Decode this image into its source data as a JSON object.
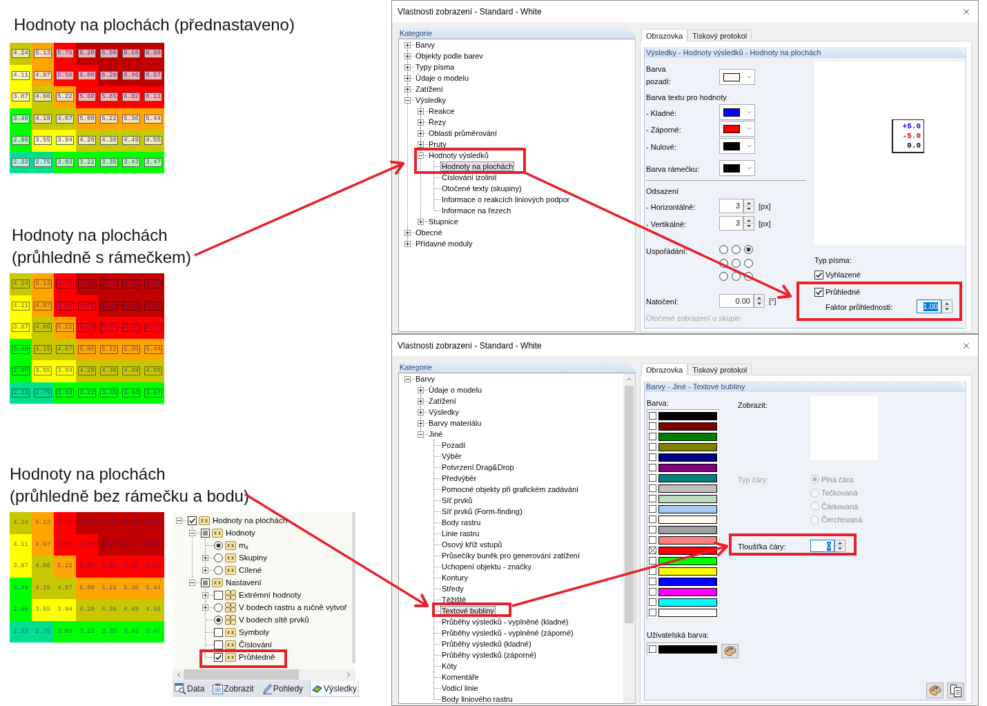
{
  "examples": [
    {
      "kind": "opaque_framed",
      "title": [
        "Hodnoty na plochách (přednastaveno)"
      ],
      "rows": [
        {
          "cells": [
            {
              "value": "4.24",
              "color": "#c8c800"
            },
            {
              "value": "5.13",
              "color": "#ffa500"
            },
            {
              "value": "5.76",
              "color": "#ff0000"
            },
            {
              "value": "6.20",
              "color": "#c00000"
            },
            {
              "value": "6.50",
              "color": "#c00000"
            },
            {
              "value": "6.69",
              "color": "#c00000"
            },
            {
              "value": "6.80",
              "color": "#c00000"
            }
          ]
        },
        {
          "cells": [
            {
              "value": "4.11",
              "color": "#ffff00"
            },
            {
              "value": "4.97",
              "color": "#ffa500"
            },
            {
              "value": "5.58",
              "color": "#ff0000"
            },
            {
              "value": "6.00",
              "color": "#ff0000"
            },
            {
              "value": "6.28",
              "color": "#c00000"
            },
            {
              "value": "6.46",
              "color": "#c00000"
            },
            {
              "value": "6.57",
              "color": "#c00000"
            }
          ]
        },
        {
          "cells": [
            {
              "value": "3.87",
              "color": "#ffff00"
            },
            {
              "value": "4.66",
              "color": "#c8c800"
            },
            {
              "value": "5.22",
              "color": "#ffa500"
            },
            {
              "value": "5.60",
              "color": "#ff0000"
            },
            {
              "value": "5.85",
              "color": "#ff0000"
            },
            {
              "value": "6.02",
              "color": "#ff0000"
            },
            {
              "value": "6.11",
              "color": "#ff0000"
            }
          ]
        },
        {
          "cells": [
            {
              "value": "3.49",
              "color": "#00ff00"
            },
            {
              "value": "4.19",
              "color": "#c8c800"
            },
            {
              "value": "4.67",
              "color": "#c8c800"
            },
            {
              "value": "5.00",
              "color": "#ffa500"
            },
            {
              "value": "5.22",
              "color": "#ffa500"
            },
            {
              "value": "5.36",
              "color": "#ffa500"
            },
            {
              "value": "5.44",
              "color": "#ffa500"
            }
          ]
        },
        {
          "cells": [
            {
              "value": "2.98",
              "color": "#00ff00"
            },
            {
              "value": "3.55",
              "color": "#ffff00"
            },
            {
              "value": "3.94",
              "color": "#ffff00"
            },
            {
              "value": "4.20",
              "color": "#c8c800"
            },
            {
              "value": "4.38",
              "color": "#c8c800"
            },
            {
              "value": "4.49",
              "color": "#c8c800"
            },
            {
              "value": "4.55",
              "color": "#c8c800"
            }
          ]
        },
        {
          "cells": [
            {
              "value": "2.33",
              "color": "#00e08c"
            },
            {
              "value": "2.75",
              "color": "#00e08c"
            },
            {
              "value": "3.03",
              "color": "#00ff00"
            },
            {
              "value": "3.22",
              "color": "#00ff00"
            },
            {
              "value": "3.35",
              "color": "#00ff00"
            },
            {
              "value": "3.43",
              "color": "#00ff00"
            },
            {
              "value": "3.47",
              "color": "#00ff00"
            }
          ]
        }
      ]
    },
    {
      "kind": "transparent_framed",
      "title": [
        "Hodnoty na plochách",
        "(průhledně s rámečkem)"
      ],
      "rows": [
        {
          "cells": [
            {
              "value": "4.24",
              "color": "#c8c800"
            },
            {
              "value": "5.13",
              "color": "#ffa500"
            },
            {
              "value": "5.76",
              "color": "#ff0000"
            },
            {
              "value": "6.20",
              "color": "#c00000"
            },
            {
              "value": "6.50",
              "color": "#c00000"
            },
            {
              "value": "6.69",
              "color": "#c00000"
            },
            {
              "value": "6.80",
              "color": "#c00000"
            }
          ]
        },
        {
          "cells": [
            {
              "value": "4.11",
              "color": "#ffff00"
            },
            {
              "value": "4.97",
              "color": "#ffa500"
            },
            {
              "value": "5.58",
              "color": "#ff0000"
            },
            {
              "value": "6.00",
              "color": "#ff0000"
            },
            {
              "value": "6.28",
              "color": "#c00000"
            },
            {
              "value": "6.46",
              "color": "#c00000"
            },
            {
              "value": "6.57",
              "color": "#c00000"
            }
          ]
        },
        {
          "cells": [
            {
              "value": "3.87",
              "color": "#ffff00"
            },
            {
              "value": "4.66",
              "color": "#c8c800"
            },
            {
              "value": "5.22",
              "color": "#ffa500"
            },
            {
              "value": "5.60",
              "color": "#ff0000"
            },
            {
              "value": "5.85",
              "color": "#ff0000"
            },
            {
              "value": "6.02",
              "color": "#ff0000"
            },
            {
              "value": "6.11",
              "color": "#ff0000"
            }
          ]
        },
        {
          "cells": [
            {
              "value": "3.49",
              "color": "#00ff00"
            },
            {
              "value": "4.19",
              "color": "#c8c800"
            },
            {
              "value": "4.67",
              "color": "#c8c800"
            },
            {
              "value": "5.00",
              "color": "#ffa500"
            },
            {
              "value": "5.22",
              "color": "#ffa500"
            },
            {
              "value": "5.36",
              "color": "#ffa500"
            },
            {
              "value": "5.44",
              "color": "#ffa500"
            }
          ]
        },
        {
          "cells": [
            {
              "value": "2.98",
              "color": "#00ff00"
            },
            {
              "value": "3.55",
              "color": "#ffff00"
            },
            {
              "value": "3.94",
              "color": "#ffff00"
            },
            {
              "value": "4.20",
              "color": "#c8c800"
            },
            {
              "value": "4.38",
              "color": "#c8c800"
            },
            {
              "value": "4.49",
              "color": "#c8c800"
            },
            {
              "value": "4.55",
              "color": "#c8c800"
            }
          ]
        },
        {
          "cells": [
            {
              "value": "2.33",
              "color": "#00e08c"
            },
            {
              "value": "2.75",
              "color": "#00e08c"
            },
            {
              "value": "3.03",
              "color": "#00ff00"
            },
            {
              "value": "3.22",
              "color": "#00ff00"
            },
            {
              "value": "3.35",
              "color": "#00ff00"
            },
            {
              "value": "3.43",
              "color": "#00ff00"
            },
            {
              "value": "3.47",
              "color": "#00ff00"
            }
          ]
        }
      ]
    },
    {
      "kind": "transparent_plain",
      "title": [
        "Hodnoty na plochách",
        "(průhledně bez rámečku a bodu)"
      ],
      "rows": [
        {
          "cells": [
            {
              "value": "4.24",
              "color": "#c8c800"
            },
            {
              "value": "5.13",
              "color": "#ffa500"
            },
            {
              "value": "5.76",
              "color": "#ff0000"
            },
            {
              "value": "6.20",
              "color": "#c00000"
            },
            {
              "value": "6.50",
              "color": "#c00000"
            },
            {
              "value": "6.69",
              "color": "#c00000"
            },
            {
              "value": "6.80",
              "color": "#c00000"
            }
          ]
        },
        {
          "cells": [
            {
              "value": "4.11",
              "color": "#ffff00"
            },
            {
              "value": "4.97",
              "color": "#ffa500"
            },
            {
              "value": "5.58",
              "color": "#ff0000"
            },
            {
              "value": "6.00",
              "color": "#ff0000"
            },
            {
              "value": "6.28",
              "color": "#c00000"
            },
            {
              "value": "6.46",
              "color": "#c00000"
            },
            {
              "value": "6.57",
              "color": "#c00000"
            }
          ]
        },
        {
          "cells": [
            {
              "value": "3.87",
              "color": "#ffff00"
            },
            {
              "value": "4.66",
              "color": "#c8c800"
            },
            {
              "value": "5.22",
              "color": "#ffa500"
            },
            {
              "value": "5.60",
              "color": "#ff0000"
            },
            {
              "value": "5.85",
              "color": "#ff0000"
            },
            {
              "value": "6.02",
              "color": "#ff0000"
            },
            {
              "value": "6.11",
              "color": "#ff0000"
            }
          ]
        },
        {
          "cells": [
            {
              "value": "3.49",
              "color": "#00ff00"
            },
            {
              "value": "4.19",
              "color": "#c8c800"
            },
            {
              "value": "4.67",
              "color": "#c8c800"
            },
            {
              "value": "5.00",
              "color": "#ffa500"
            },
            {
              "value": "5.22",
              "color": "#ffa500"
            },
            {
              "value": "5.36",
              "color": "#ffa500"
            },
            {
              "value": "5.44",
              "color": "#ffa500"
            }
          ]
        },
        {
          "cells": [
            {
              "value": "2.98",
              "color": "#00ff00"
            },
            {
              "value": "3.55",
              "color": "#ffff00"
            },
            {
              "value": "3.94",
              "color": "#ffff00"
            },
            {
              "value": "4.20",
              "color": "#c8c800"
            },
            {
              "value": "4.38",
              "color": "#c8c800"
            },
            {
              "value": "4.49",
              "color": "#c8c800"
            },
            {
              "value": "4.55",
              "color": "#c8c800"
            }
          ]
        },
        {
          "cells": [
            {
              "value": "2.33",
              "color": "#00e08c"
            },
            {
              "value": "2.75",
              "color": "#00e08c"
            },
            {
              "value": "3.03",
              "color": "#00ff00"
            },
            {
              "value": "3.22",
              "color": "#00ff00"
            },
            {
              "value": "3.35",
              "color": "#00ff00"
            },
            {
              "value": "3.43",
              "color": "#00ff00"
            },
            {
              "value": "3.47",
              "color": "#00ff00"
            }
          ]
        }
      ],
      "navigator": {
        "tree": [
          {
            "label": "Hodnoty na plochách",
            "kind": "check_tag",
            "checked": true,
            "partial": false,
            "expanded": true,
            "children": [
              {
                "label": "Hodnoty",
                "kind": "check_tag",
                "checked": false,
                "partial": true,
                "expanded": true,
                "children": [
                  {
                    "label": "m$_{x}$",
                    "kind": "radio_tag",
                    "selected": true
                  },
                  {
                    "label": "Skupiny",
                    "kind": "radio_tag",
                    "selected": false,
                    "expanded": false
                  },
                  {
                    "label": "Cílené",
                    "kind": "radio_tag",
                    "selected": false,
                    "expanded": false
                  }
                ]
              },
              {
                "label": "Nastavení",
                "kind": "check_tag",
                "checked": false,
                "partial": true,
                "expanded": true,
                "children": [
                  {
                    "label": "Extrémní hodnoty",
                    "kind": "check_grid",
                    "checked": false,
                    "partial": false,
                    "expanded": false
                  },
                  {
                    "label": "V bodech rastru a ručně vytvoř",
                    "kind": "radio_grid",
                    "selected": false,
                    "expanded": false
                  },
                  {
                    "label": "V bodech sítě prvků",
                    "kind": "radio_grid",
                    "selected": true
                  },
                  {
                    "label": "Symboly",
                    "kind": "check_tag",
                    "checked": false,
                    "partial": false
                  },
                  {
                    "label": "Číslování",
                    "kind": "check_tag",
                    "checked": false,
                    "partial": false
                  },
                  {
                    "label": "Průhledně",
                    "kind": "check_tag",
                    "checked": true,
                    "partial": false
                  }
                ]
              }
            ]
          }
        ],
        "tabs": [
          {
            "label": "Data",
            "selected": false
          },
          {
            "label": "Zobrazit",
            "selected": false
          },
          {
            "label": "Pohledy",
            "selected": false
          },
          {
            "label": "Výsledky",
            "selected": true
          }
        ]
      }
    }
  ],
  "top_dialog": {
    "title": "Vlastnosti zobrazení - Standard - White",
    "category_header": "Kategorie",
    "tree": [
      {
        "label": "Barvy",
        "expanded": false,
        "selected": false
      },
      {
        "label": "Objekty podle barev",
        "expanded": false,
        "selected": false
      },
      {
        "label": "Typy písma",
        "expanded": false,
        "selected": false
      },
      {
        "label": "Údaje o modelu",
        "expanded": false,
        "selected": false
      },
      {
        "label": "Zatížení",
        "expanded": false,
        "selected": false
      },
      {
        "label": "Výsledky",
        "expanded": true,
        "selected": false,
        "children": [
          {
            "label": "Reakce",
            "expanded": false,
            "selected": false
          },
          {
            "label": "Řezy",
            "expanded": false,
            "selected": false
          },
          {
            "label": "Oblasti průměrování",
            "expanded": false,
            "selected": false
          },
          {
            "label": "Pruty",
            "expanded": false,
            "selected": false
          },
          {
            "label": "Hodnoty výsledků",
            "expanded": true,
            "selected": false,
            "children": [
              {
                "label": "Hodnoty na plochách",
                "selected": true
              },
              {
                "label": "Číslování izolinií",
                "selected": false
              },
              {
                "label": "Otočené texty (skupiny)",
                "selected": false
              },
              {
                "label": "Informace o reakcích liniových podpor",
                "selected": false
              },
              {
                "label": "Informace na řezech",
                "selected": false
              }
            ]
          },
          {
            "label": "Stupnice",
            "expanded": false,
            "selected": false
          }
        ]
      },
      {
        "label": "Obecné",
        "expanded": false,
        "selected": false
      },
      {
        "label": "Přídavné moduly",
        "expanded": false,
        "selected": false
      }
    ],
    "tabs": [
      {
        "label": "Obrazovka",
        "selected": true
      },
      {
        "label": "Tiskový protokol",
        "selected": false
      }
    ],
    "section_title": "Výsledky - Hodnoty výsledků - Hodnoty na plochách",
    "background_color": {
      "label": [
        "Barva",
        "pozadí:"
      ],
      "color": "#fffaf0"
    },
    "text_color_heading": "Barva textu pro hodnoty",
    "text_colors": [
      {
        "label": "- Kladné:",
        "color": "#0000ff"
      },
      {
        "label": "- Záporné:",
        "color": "#ff0000"
      },
      {
        "label": "- Nulové:",
        "color": "#000000"
      }
    ],
    "frame_color": {
      "label": "Barva rámečku:",
      "color": "#000000"
    },
    "offset_heading": "Odsazení",
    "offsets": [
      {
        "label": "- Horizontálně:",
        "value": "3",
        "unit": "[px]"
      },
      {
        "label": "- Vertikálně:",
        "value": "3",
        "unit": "[px]"
      }
    ],
    "arrangement": {
      "label": "Uspořádání:",
      "rows": [
        {
          "options": [
            {
              "selected": false
            },
            {
              "selected": false
            },
            {
              "selected": true
            }
          ]
        },
        {
          "options": [
            {
              "selected": false
            },
            {
              "selected": false
            },
            {
              "selected": false
            }
          ]
        },
        {
          "options": [
            {
              "selected": false
            },
            {
              "selected": false
            },
            {
              "selected": false
            }
          ]
        }
      ]
    },
    "rotation": {
      "label": "Natočení:",
      "value": "0.00",
      "unit": "[°]"
    },
    "group_rotation": {
      "label": "Otočené zobrazení u skupin",
      "disabled": true
    },
    "preview": {
      "lines": [
        {
          "text": "+5.0",
          "color": "#0000ff"
        },
        {
          "text": "-5.0",
          "color": "#e00000"
        },
        {
          "text": "0.0",
          "color": "#000000"
        }
      ]
    },
    "font_heading": "Typ písma:",
    "font_options": [
      {
        "label": "Vyhlazené",
        "checked": true
      },
      {
        "label": "Průhledné",
        "checked": true
      }
    ],
    "transparency": {
      "label": "Faktor průhlednosti:",
      "value": "1.00",
      "highlighted": true
    }
  },
  "bottom_dialog": {
    "title": "Vlastnosti zobrazení - Standard - White",
    "category_header": "Kategorie",
    "tree": [
      {
        "label": "Barvy",
        "expanded": true,
        "selected": false,
        "children": [
          {
            "label": "Údaje o modelu",
            "expanded": false,
            "selected": false
          },
          {
            "label": "Zatížení",
            "expanded": false,
            "selected": false
          },
          {
            "label": "Výsledky",
            "expanded": false,
            "selected": false
          },
          {
            "label": "Barvy materiálu",
            "expanded": false,
            "selected": false
          },
          {
            "label": "Jiné",
            "expanded": true,
            "selected": false,
            "children": [
              {
                "label": "Pozadí",
                "selected": false
              },
              {
                "label": "Výběr",
                "selected": false
              },
              {
                "label": "Potvrzení Drag&Drop",
                "selected": false
              },
              {
                "label": "Předvýběr",
                "selected": false
              },
              {
                "label": "Pomocné objekty při grafickém zadávání",
                "selected": false
              },
              {
                "label": "Síť prvků",
                "selected": false
              },
              {
                "label": "Síť prvků (Form-finding)",
                "selected": false
              },
              {
                "label": "Body rastru",
                "selected": false
              },
              {
                "label": "Linie rastru",
                "selected": false
              },
              {
                "label": "Osový kříž vstupů",
                "selected": false
              },
              {
                "label": "Průsečíky buněk pro generování zatížení",
                "selected": false
              },
              {
                "label": "Uchopení objektu - značky",
                "selected": false
              },
              {
                "label": "Kontury",
                "selected": false
              },
              {
                "label": "Středy",
                "selected": false
              },
              {
                "label": "Těžiště",
                "selected": false
              },
              {
                "label": "Textové bubliny",
                "selected": true
              },
              {
                "label": "Průběhy výsledků - vyplněné (kladné)",
                "selected": false
              },
              {
                "label": "Průběhy výsledků - vyplněné (záporné)",
                "selected": false
              },
              {
                "label": "Průběhy výsledků (kladné)",
                "selected": false
              },
              {
                "label": "Průběhy výsledků (záporné)",
                "selected": false
              },
              {
                "label": "Kóty",
                "selected": false
              },
              {
                "label": "Komentáře",
                "selected": false
              },
              {
                "label": "Vodicí linie",
                "selected": false
              },
              {
                "label": "Body liniového rastru",
                "selected": false
              }
            ]
          }
        ]
      }
    ],
    "tabs": [
      {
        "label": "Obrazovka",
        "selected": true
      },
      {
        "label": "Tiskový protokol",
        "selected": false
      }
    ],
    "section_title": "Barvy - Jiné - Textové bubliny",
    "color_label": "Barva:",
    "palette": [
      {
        "color": "#000000",
        "checked": false
      },
      {
        "color": "#800000",
        "checked": false
      },
      {
        "color": "#008000",
        "checked": false
      },
      {
        "color": "#808000",
        "checked": false
      },
      {
        "color": "#000080",
        "checked": false
      },
      {
        "color": "#800080",
        "checked": false
      },
      {
        "color": "#008080",
        "checked": false
      },
      {
        "color": "#c0c0c0",
        "checked": false
      },
      {
        "color": "#c0dcc0",
        "checked": false
      },
      {
        "color": "#a6caf0",
        "checked": false
      },
      {
        "color": "#fffbf0",
        "checked": false
      },
      {
        "color": "#a0a0a4",
        "checked": false
      },
      {
        "color": "#ff8080",
        "checked": false
      },
      {
        "color": "#ff0000",
        "checked": true
      },
      {
        "color": "#00ff00",
        "checked": false
      },
      {
        "color": "#ffff00",
        "checked": false
      },
      {
        "color": "#0000ff",
        "checked": false
      },
      {
        "color": "#ff00ff",
        "checked": false
      },
      {
        "color": "#00ffff",
        "checked": false
      },
      {
        "color": "#ffffff",
        "checked": false
      }
    ],
    "display_label": "Zobrazit:",
    "line_type": {
      "label": "Typ čáry:",
      "disabled": true,
      "options": [
        {
          "label": "Plná čára",
          "selected": true
        },
        {
          "label": "Tečkovaná",
          "selected": false
        },
        {
          "label": "Čárkovaná",
          "selected": false
        },
        {
          "label": "Čerchovaná",
          "selected": false
        }
      ]
    },
    "line_width": {
      "label": "Tloušťka čáry:",
      "value": "0",
      "highlighted": true
    },
    "user_color": {
      "label": "Uživatelská barva:",
      "color": "#000000",
      "checked": false
    }
  }
}
